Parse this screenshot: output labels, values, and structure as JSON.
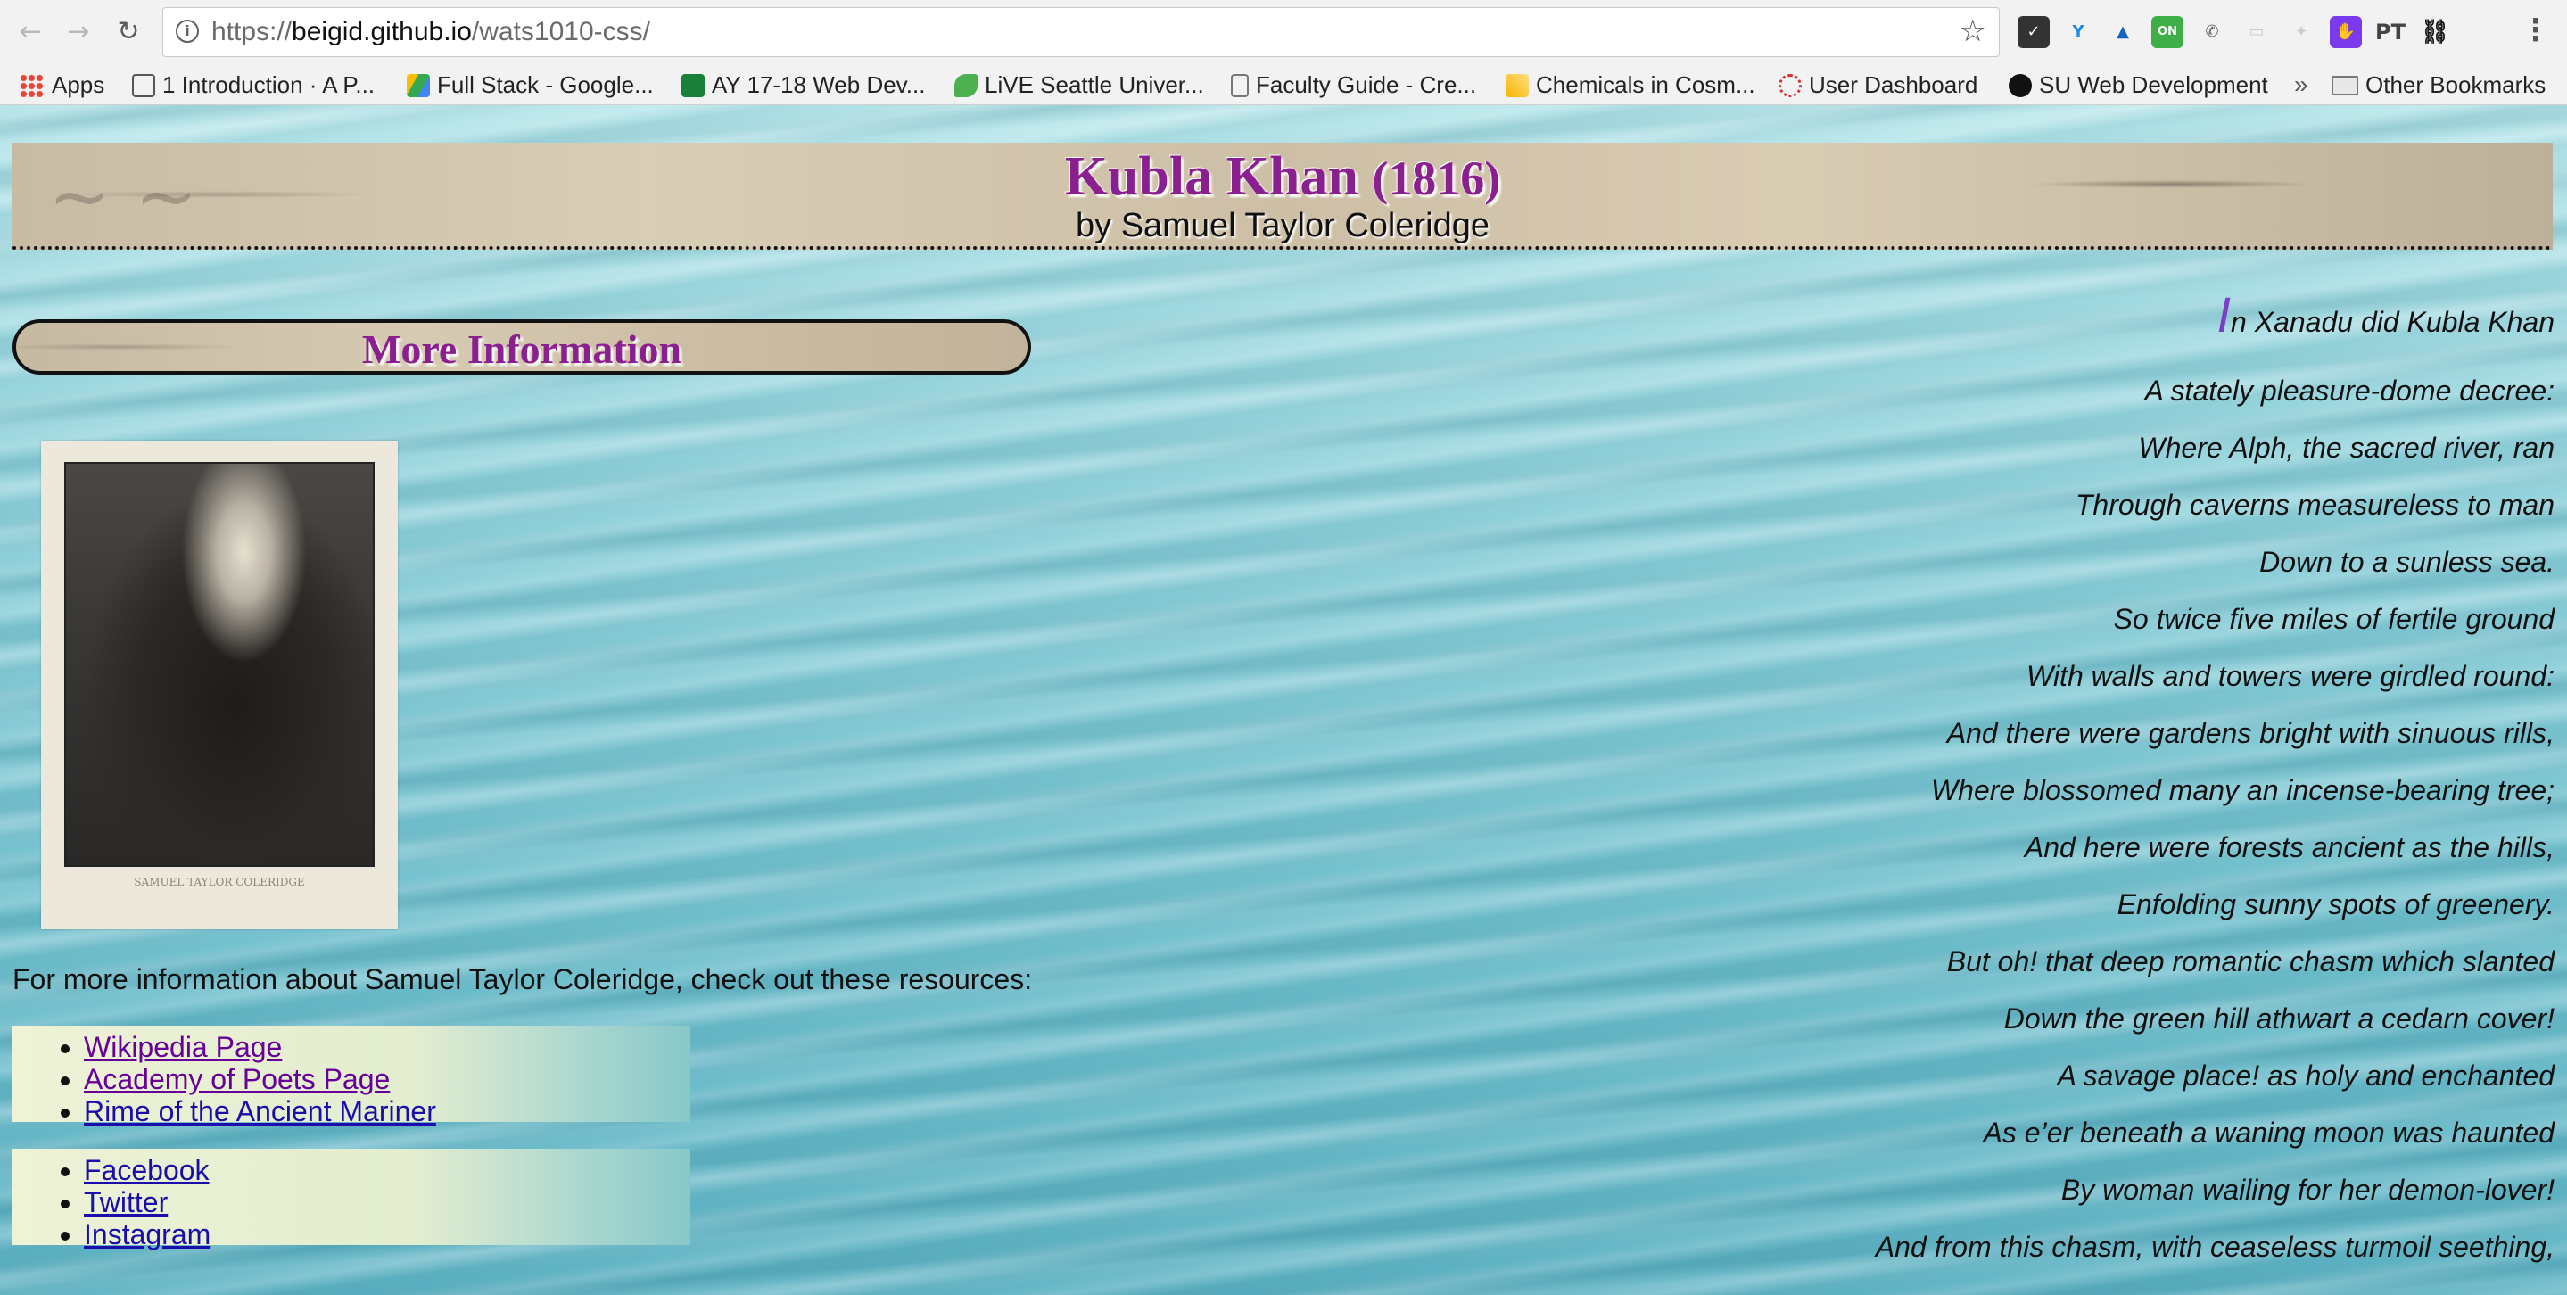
{
  "browser": {
    "url_scheme": "https://",
    "url_host": "beigid.github.io",
    "url_path": "/wats1010-css/",
    "bookmarks": [
      "Apps",
      "1 Introduction · A P...",
      "Full Stack - Google...",
      "AY 17-18 Web Dev...",
      "LiVE Seattle Univer...",
      "Faculty Guide - Cre...",
      "Chemicals in Cosm...",
      "User Dashboard",
      "SU Web Development"
    ],
    "more_bookmarks": "»",
    "other_bookmarks": "Other Bookmarks",
    "extension_icons": [
      "checklist-icon",
      "y-icon",
      "drive-icon",
      "on-icon",
      "megaphone-icon",
      "chat-icon",
      "pin-icon",
      "hand-icon",
      "pt-icon",
      "link-icon"
    ]
  },
  "page": {
    "title": "Kubla Khan",
    "year": "(1816)",
    "byline": "by Samuel Taylor Coleridge",
    "more_info_heading": "More Information",
    "portrait_caption": "SAMUEL TAYLOR COLERIDGE",
    "resources_intro": "For more information about Samuel Taylor Coleridge, check out these resources:",
    "resource_links": [
      "Wikipedia Page",
      "Academy of Poets Page",
      "Rime of the Ancient Mariner"
    ],
    "social_links": [
      "Facebook",
      "Twitter",
      "Instagram"
    ],
    "poem": {
      "drop_cap": "I",
      "first_line_rest": "n Xanadu did Kubla Khan",
      "lines": [
        "A stately pleasure-dome decree:",
        "Where Alph, the sacred river, ran",
        "Through caverns measureless to man",
        "Down to a sunless sea.",
        "So twice five miles of fertile ground",
        "With walls and towers were girdled round:",
        "And there were gardens bright with sinuous rills,",
        "Where blossomed many an incense-bearing tree;",
        "And here were forests ancient as the hills,",
        "Enfolding sunny spots of greenery.",
        "But oh! that deep romantic chasm which slanted",
        "Down the green hill athwart a cedarn cover!",
        "A savage place! as holy and enchanted",
        "As e’er beneath a waning moon was haunted",
        "By woman wailing for her demon-lover!",
        "And from this chasm, with ceaseless turmoil seething,"
      ]
    }
  },
  "colors": {
    "title": "#8a1f8f",
    "drop_cap": "#7b3ec6",
    "link": "#1a0dab",
    "visited_link": "#660099"
  }
}
